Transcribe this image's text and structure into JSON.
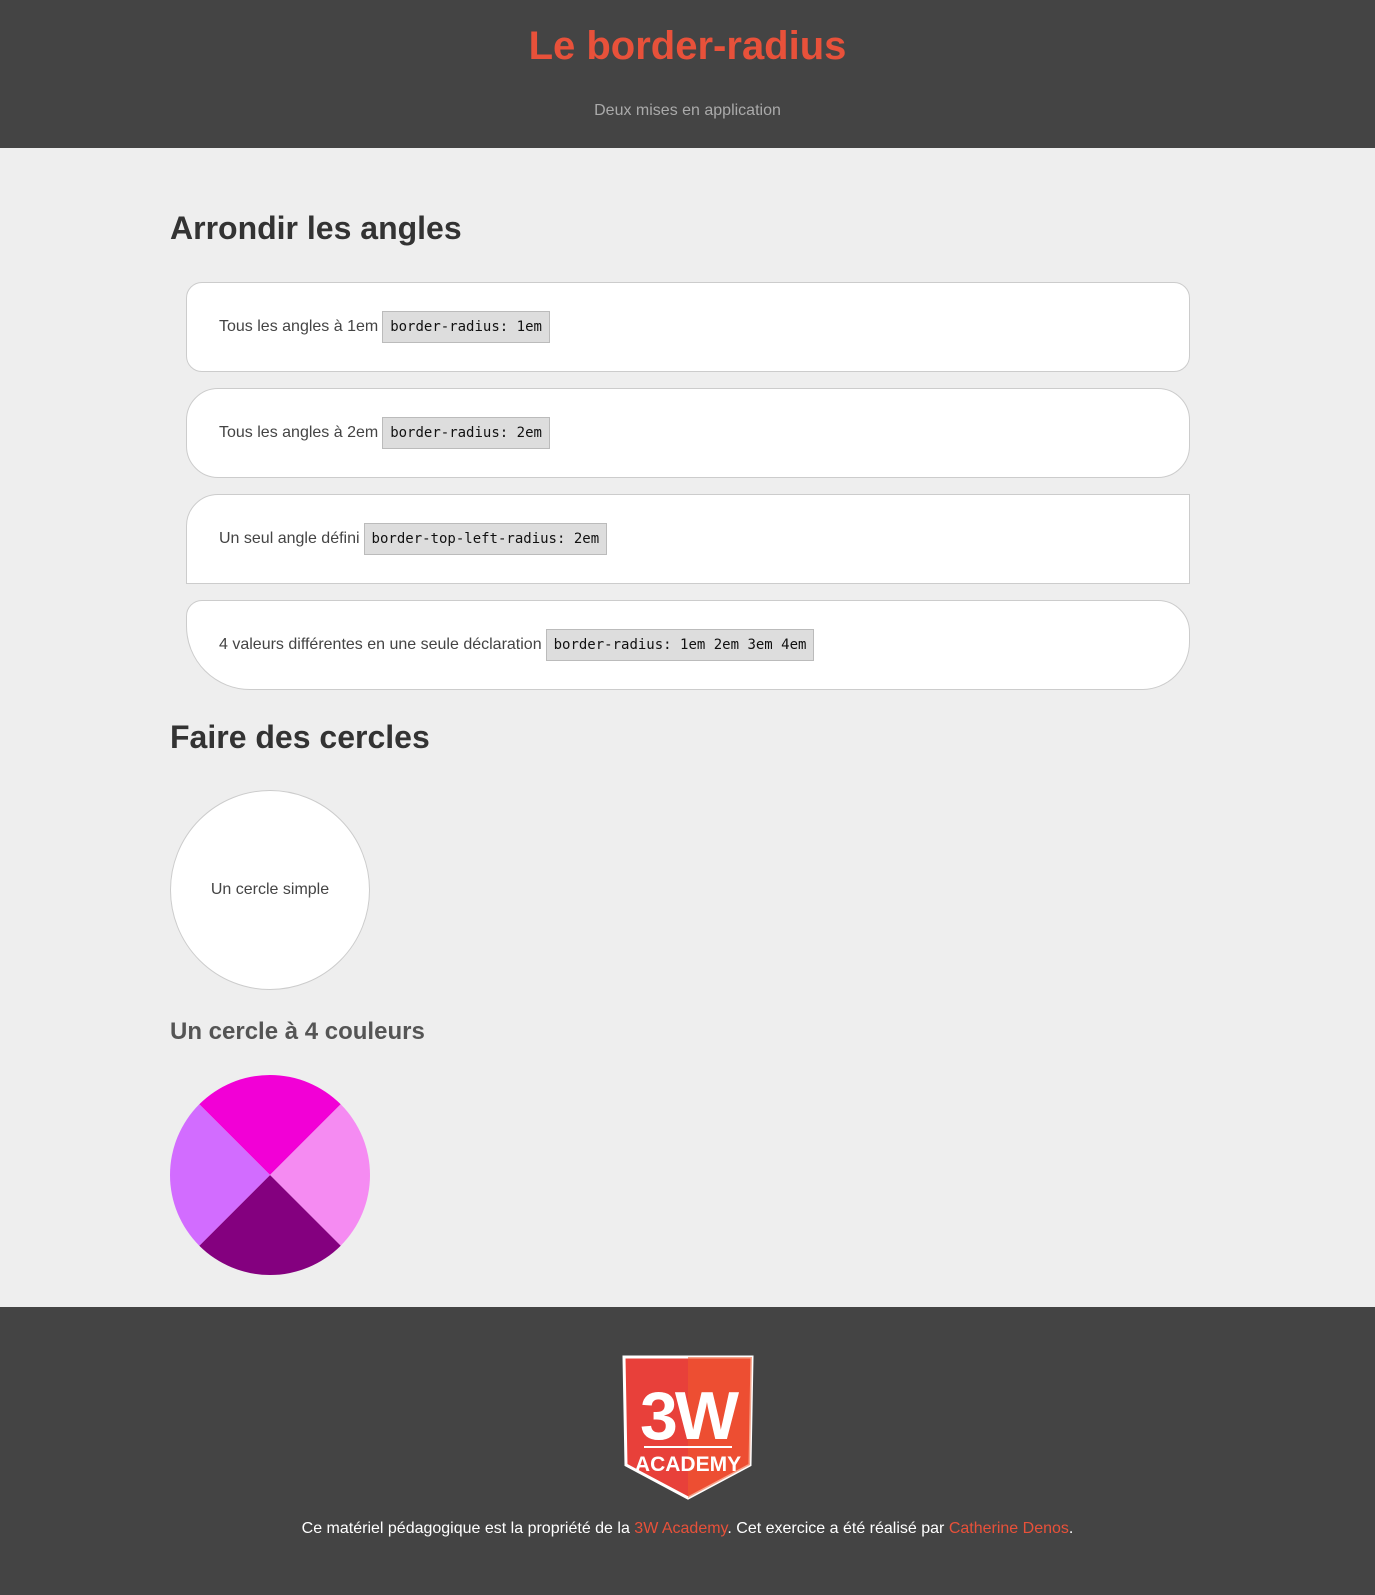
{
  "header": {
    "title": "Le border-radius",
    "subtitle": "Deux mises en application"
  },
  "section_corners": {
    "title": "Arrondir les angles",
    "items": [
      {
        "label": "Tous les angles à 1em",
        "code": "border-radius: 1em"
      },
      {
        "label": "Tous les angles à 2em",
        "code": "border-radius: 2em"
      },
      {
        "label": "Un seul angle défini",
        "code": "border-top-left-radius: 2em"
      },
      {
        "label": "4 valeurs différentes en une seule déclaration",
        "code": "border-radius: 1em 2em 3em 4em"
      }
    ]
  },
  "section_circles": {
    "title": "Faire des cercles",
    "simple_circle_label": "Un cercle simple",
    "four_color_title": "Un cercle à 4 couleurs",
    "four_color_colors": {
      "top": "#f200d6",
      "right": "#f58bf2",
      "bottom": "#84007f",
      "left": "#d26cff"
    }
  },
  "footer": {
    "logo_text_main": "3W",
    "logo_text_sub": "ACADEMY",
    "credit_prefix": "Ce matériel pédagogique est la propriété de la ",
    "academy_link": "3W Academy",
    "credit_middle": ". Cet exercice a été réalisé par ",
    "author_link": "Catherine Denos",
    "credit_suffix": "."
  },
  "colors": {
    "accent": "#e8513a",
    "header_bg": "#444444",
    "page_bg": "#eeeeee"
  }
}
